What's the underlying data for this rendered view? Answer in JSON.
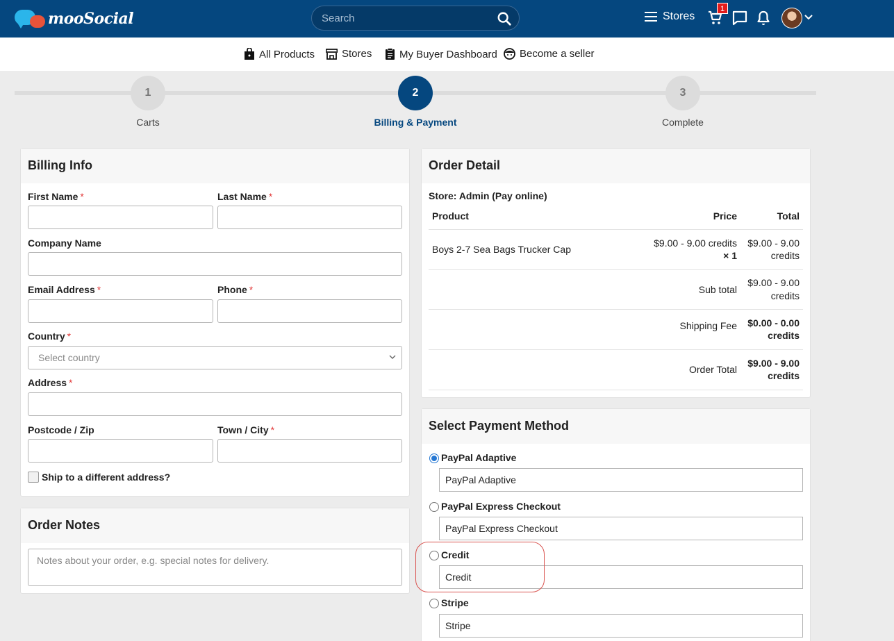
{
  "header": {
    "logo_text": "mooSocial",
    "search_placeholder": "Search",
    "stores_label": "Stores",
    "cart_count": "1"
  },
  "subnav": {
    "all_products": "All Products",
    "stores": "Stores",
    "buyer_dashboard": "My Buyer Dashboard",
    "become_seller": "Become a seller"
  },
  "steps": [
    {
      "num": "1",
      "label": "Carts"
    },
    {
      "num": "2",
      "label": "Billing & Payment"
    },
    {
      "num": "3",
      "label": "Complete"
    }
  ],
  "billing": {
    "title": "Billing Info",
    "first_name": "First Name",
    "last_name": "Last Name",
    "company": "Company Name",
    "email": "Email Address",
    "phone": "Phone",
    "country": "Country",
    "country_placeholder": "Select country",
    "address": "Address",
    "postcode": "Postcode / Zip",
    "town": "Town / City",
    "ship_diff": "Ship to a different address?",
    "required_mark": "*"
  },
  "notes": {
    "title": "Order Notes",
    "placeholder": "Notes about your order, e.g. special notes for delivery."
  },
  "order": {
    "title": "Order Detail",
    "store": "Store: Admin (Pay online)",
    "col_product": "Product",
    "col_price": "Price",
    "col_total": "Total",
    "item_name": "Boys 2-7 Sea Bags Trucker Cap",
    "item_price": "$9.00 - 9.00 credits",
    "item_qty": "× 1",
    "item_total_1": "$9.00 - 9.00",
    "item_total_2": "credits",
    "subtotal_label": "Sub total",
    "subtotal_1": "$9.00 - 9.00",
    "subtotal_2": "credits",
    "shipping_label": "Shipping Fee",
    "shipping_1": "$0.00 - 0.00",
    "shipping_2": "credits",
    "order_total_label": "Order Total",
    "order_total_1": "$9.00 - 9.00",
    "order_total_2": "credits"
  },
  "payment": {
    "title": "Select Payment Method",
    "methods": [
      {
        "label": "PayPal Adaptive",
        "desc": "PayPal Adaptive",
        "selected": true
      },
      {
        "label": "PayPal Express Checkout",
        "desc": "PayPal Express Checkout",
        "selected": false
      },
      {
        "label": "Credit",
        "desc": "Credit",
        "selected": false
      },
      {
        "label": "Stripe",
        "desc": "Stripe",
        "selected": false
      }
    ]
  },
  "colors": {
    "brand": "#05477f",
    "required": "#e23838",
    "radio_selected": "#2577d3",
    "highlight": "#d9534f"
  }
}
